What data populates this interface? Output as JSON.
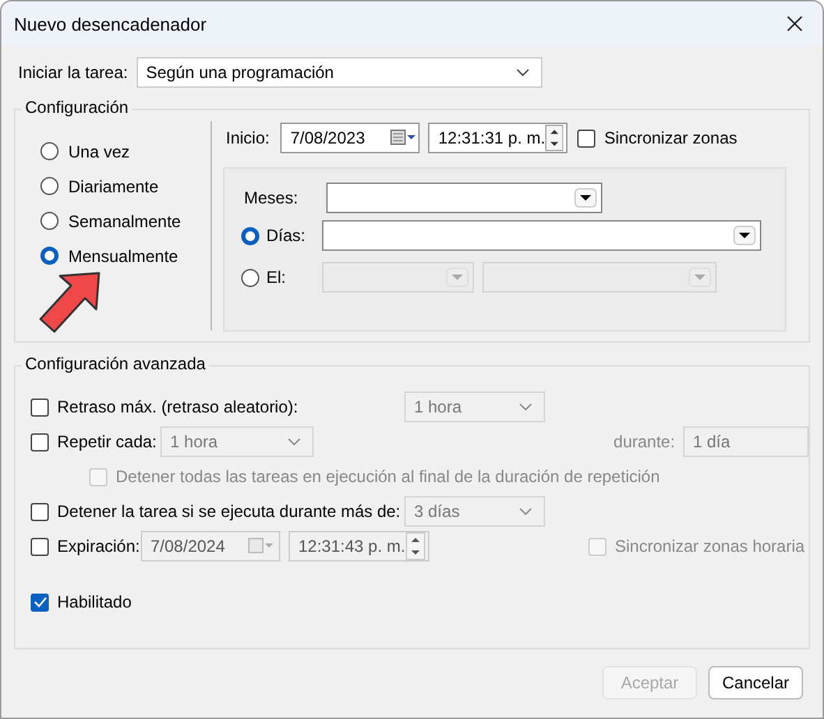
{
  "window": {
    "title": "Nuevo desencadenador"
  },
  "start_task": {
    "label": "Iniciar la tarea:",
    "value": "Según una programación"
  },
  "settings": {
    "title": "Configuración",
    "schedule_options": [
      {
        "label": "Una vez",
        "selected": false
      },
      {
        "label": "Diariamente",
        "selected": false
      },
      {
        "label": "Semanalmente",
        "selected": false
      },
      {
        "label": "Mensualmente",
        "selected": true
      }
    ],
    "start": {
      "label": "Inicio:",
      "date": "7/08/2023",
      "time": "12:31:31 p. m.",
      "sync_label": "Sincronizar zonas",
      "sync_checked": false
    },
    "months": {
      "label": "Meses:"
    },
    "day_modes": [
      {
        "label": "Días:",
        "selected": true
      },
      {
        "label": "El:",
        "selected": false
      }
    ]
  },
  "advanced": {
    "title": "Configuración avanzada",
    "random_delay": {
      "label": "Retraso máx. (retraso aleatorio):",
      "checked": false,
      "value": "1 hora"
    },
    "repeat": {
      "label": "Repetir cada:",
      "checked": false,
      "value": "1 hora",
      "duration_label": "durante:",
      "duration_value": "1 día"
    },
    "stop_all": {
      "label": "Detener todas las tareas en ejecución al final de la duración de repetición",
      "checked": false
    },
    "stop_if": {
      "label": "Detener la tarea si se ejecuta durante más de:",
      "checked": false,
      "value": "3 días"
    },
    "expiration": {
      "label": "Expiración:",
      "checked": false,
      "date": "7/08/2024",
      "time": "12:31:43 p. m.",
      "sync_label": "Sincronizar zonas horaria",
      "sync_checked": false
    },
    "enabled": {
      "label": "Habilitado",
      "checked": true
    }
  },
  "buttons": [
    {
      "label": "Aceptar",
      "disabled": true
    },
    {
      "label": "Cancelar",
      "disabled": false
    }
  ]
}
